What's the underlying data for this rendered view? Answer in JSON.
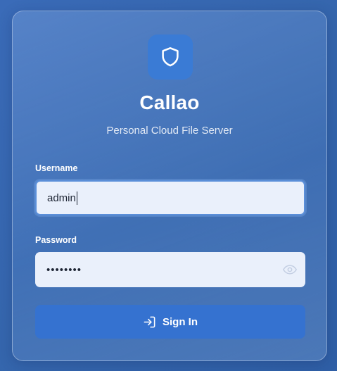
{
  "app": {
    "name": "Callao",
    "tagline": "Personal Cloud File Server"
  },
  "form": {
    "username_label": "Username",
    "username_value": "admin",
    "password_label": "Password",
    "password_masked": "••••••••",
    "submit_label": "Sign In"
  },
  "icons": {
    "logo": "shield-icon",
    "password_toggle": "eye-icon",
    "submit": "sign-in-icon"
  },
  "colors": {
    "accent": "#3572d0",
    "logo_bg": "#3a7bd5",
    "input_bg": "#eaf0fb"
  }
}
